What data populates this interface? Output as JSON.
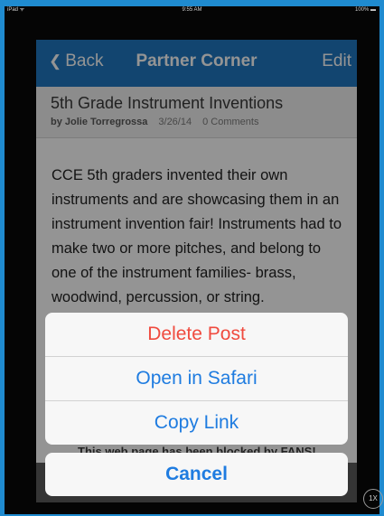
{
  "status_bar": {
    "carrier": "iPad ᯤ",
    "time": "9:55 AM",
    "battery": "100% ▬"
  },
  "navbar": {
    "back_label": "Back",
    "title": "Partner Corner",
    "edit_label": "Edit"
  },
  "post": {
    "title": "5th Grade Instrument Inventions",
    "author": "by Jolie Torregrossa",
    "date": "3/26/14",
    "comments": "0 Comments",
    "body": "CCE 5th graders invented their own instruments and are showcasing them in an instrument invention fair! Instruments had to make two or more pitches, and belong to one of the instrument families- brass, woodwind, percussion, or string."
  },
  "blocked_notice": "This web page has been blocked by FANS!",
  "action_sheet": {
    "items": [
      {
        "label": "Delete Post",
        "style": "destructive"
      },
      {
        "label": "Open in Safari",
        "style": "default"
      },
      {
        "label": "Copy Link",
        "style": "default"
      }
    ],
    "cancel_label": "Cancel"
  },
  "zoom_badge": "1X",
  "colors": {
    "accent": "#1f7ce0",
    "navbar": "#1f78c1",
    "destructive": "#f04b3f",
    "frame": "#1f8bd0"
  }
}
